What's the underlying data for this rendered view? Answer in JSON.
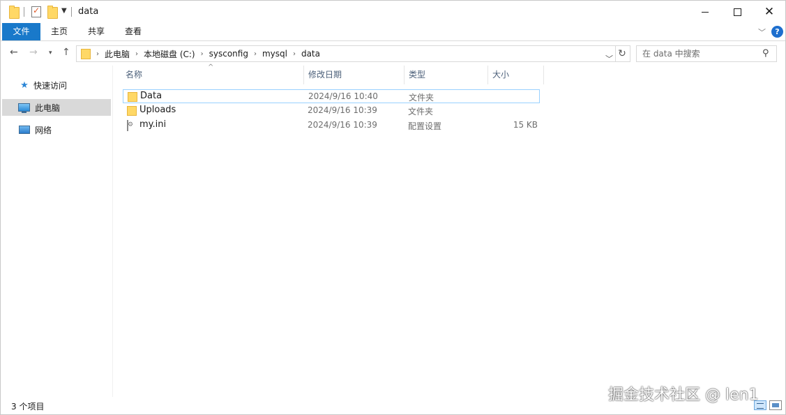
{
  "window": {
    "title": "data"
  },
  "ribbon": {
    "tabs": [
      "文件",
      "主页",
      "共享",
      "查看"
    ],
    "help_label": "?"
  },
  "address": {
    "crumbs": [
      "此电脑",
      "本地磁盘 (C:)",
      "sysconfig",
      "mysql",
      "data"
    ]
  },
  "search": {
    "placeholder": "在 data 中搜索"
  },
  "navpane": {
    "items": [
      {
        "label": "快速访问",
        "icon": "star-icon"
      },
      {
        "label": "此电脑",
        "icon": "computer-icon",
        "selected": true
      },
      {
        "label": "网络",
        "icon": "network-icon"
      }
    ]
  },
  "columns": {
    "name": "名称",
    "date": "修改日期",
    "type": "类型",
    "size": "大小"
  },
  "files": [
    {
      "name": "Data",
      "date": "2024/9/16 10:40",
      "type": "文件夹",
      "size": "",
      "icon": "folder-icon",
      "selected": true
    },
    {
      "name": "Uploads",
      "date": "2024/9/16 10:39",
      "type": "文件夹",
      "size": "",
      "icon": "folder-icon"
    },
    {
      "name": "my.ini",
      "date": "2024/9/16 10:39",
      "type": "配置设置",
      "size": "15 KB",
      "icon": "ini-file-icon"
    }
  ],
  "status": {
    "item_count": "3 个项目"
  },
  "watermark": "掘金技术社区 @ len1",
  "colors": {
    "accent": "#1979ca",
    "selected_border": "#99d1ff",
    "nav_selected": "#d9d9d9",
    "folder": "#ffd866"
  }
}
